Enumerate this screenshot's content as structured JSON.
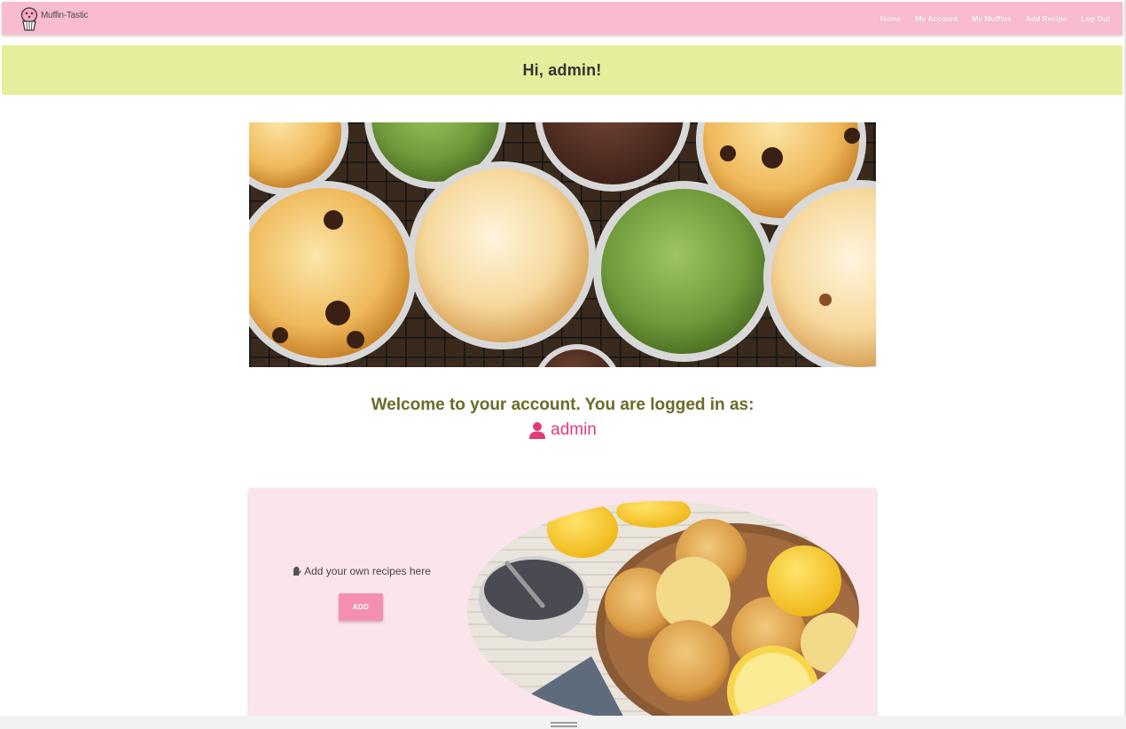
{
  "navbar": {
    "brand": "Muffin-Tastic",
    "links": [
      "Home",
      "My Account",
      "My Muffins",
      "Add Recipe",
      "Log Out"
    ]
  },
  "greeting": "Hi, admin!",
  "welcome": {
    "text": "Welcome to your account. You are logged in as:",
    "username": "admin"
  },
  "card": {
    "text": "Add your own recipes here",
    "button_label": "ADD"
  },
  "colors": {
    "navbar": "#f8bbd0",
    "greeting_banner": "#e6ee9c",
    "card_background": "#fce4ec",
    "button": "#f48fb1",
    "username": "#e23b7c",
    "welcome_text": "#6b6b2a"
  },
  "icons": {
    "brand": "muffin-logo-icon",
    "user": "user-icon",
    "card": "oven-mitt-icon"
  }
}
